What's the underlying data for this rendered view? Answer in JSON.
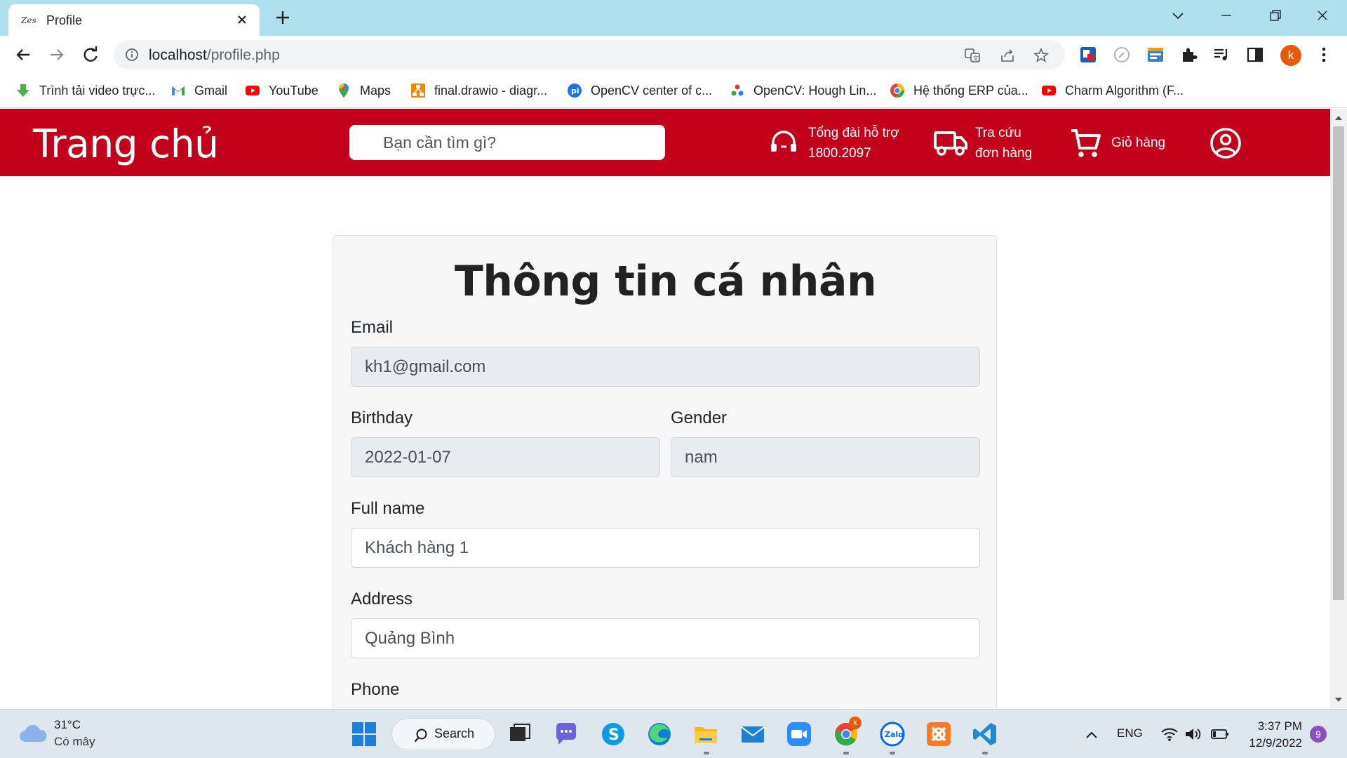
{
  "browser": {
    "tab_title": "Profile",
    "url_host": "localhost",
    "url_path": "/profile.php",
    "profile_initial": "k",
    "bookmarks": [
      {
        "label": "Trình tải video trực...",
        "icon": "download-arrow-icon"
      },
      {
        "label": "Gmail",
        "icon": "gmail-icon"
      },
      {
        "label": "YouTube",
        "icon": "youtube-icon"
      },
      {
        "label": "Maps",
        "icon": "maps-pin-icon"
      },
      {
        "label": "final.drawio - diagr...",
        "icon": "drawio-icon"
      },
      {
        "label": "OpenCV center of c...",
        "icon": "pyimagesearch-icon"
      },
      {
        "label": "OpenCV: Hough Lin...",
        "icon": "opencv-icon"
      },
      {
        "label": "Hệ thống ERP của...",
        "icon": "erp-icon"
      },
      {
        "label": "Charm Algorithm (F...",
        "icon": "youtube-icon"
      }
    ]
  },
  "header": {
    "brand": "Trang chủ",
    "search_placeholder": "Bạn cần tìm gì?",
    "hotline_line1": "Tổng đài hỗ trợ",
    "hotline_line2": "1800.2097",
    "track_line1": "Tra cứu",
    "track_line2": "đơn hàng",
    "cart_label": "Giỏ hàng"
  },
  "profile": {
    "title": "Thông tin cá nhân",
    "email_label": "Email",
    "email_value": "kh1@gmail.com",
    "birthday_label": "Birthday",
    "birthday_value": "2022-01-07",
    "gender_label": "Gender",
    "gender_value": "nam",
    "fullname_label": "Full name",
    "fullname_value": "Khách hàng 1",
    "address_label": "Address",
    "address_value": "Quảng Bình",
    "phone_label": "Phone"
  },
  "taskbar": {
    "weather_temp": "31°C",
    "weather_desc": "Có mây",
    "search_label": "Search",
    "language": "ENG",
    "time": "3:37 PM",
    "date": "12/9/2022",
    "notification_count": "9",
    "chrome_badge": "k"
  },
  "colors": {
    "brand_red": "#c2001a",
    "tab_strip": "#aee0ee",
    "profile_orange": "#e8590c"
  }
}
